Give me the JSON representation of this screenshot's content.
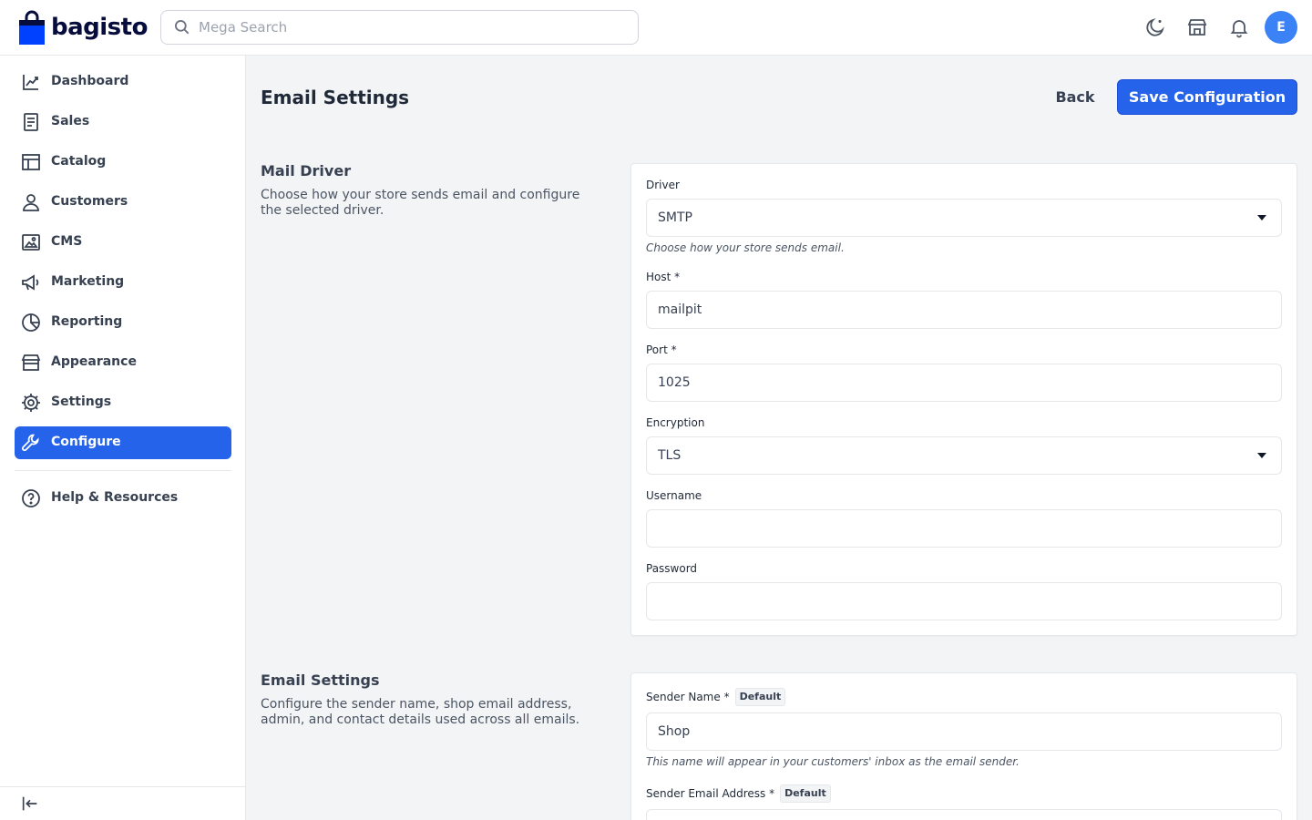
{
  "brand": {
    "name": "bagisto",
    "color": "#0041ff"
  },
  "search": {
    "placeholder": "Mega Search"
  },
  "header": {
    "avatar_initial": "E",
    "icons": [
      "dark-mode-icon",
      "storefront-icon",
      "notification-bell-icon"
    ]
  },
  "sidebar": {
    "items": [
      {
        "label": "Dashboard",
        "icon": "dashboard-icon"
      },
      {
        "label": "Sales",
        "icon": "sales-icon"
      },
      {
        "label": "Catalog",
        "icon": "catalog-icon"
      },
      {
        "label": "Customers",
        "icon": "customers-icon"
      },
      {
        "label": "CMS",
        "icon": "cms-icon"
      },
      {
        "label": "Marketing",
        "icon": "marketing-icon"
      },
      {
        "label": "Reporting",
        "icon": "reporting-icon"
      },
      {
        "label": "Appearance",
        "icon": "appearance-icon"
      },
      {
        "label": "Settings",
        "icon": "settings-icon"
      },
      {
        "label": "Configure",
        "icon": "configure-icon",
        "active": true
      }
    ],
    "help": {
      "label": "Help & Resources",
      "icon": "help-icon"
    }
  },
  "page": {
    "title": "Email Settings",
    "back_label": "Back",
    "save_label": "Save Configuration"
  },
  "mail_driver": {
    "title": "Mail Driver",
    "description": "Choose how your store sends email and configure the selected driver.",
    "driver": {
      "label": "Driver",
      "value": "SMTP",
      "hint": "Choose how your store sends email."
    },
    "host": {
      "label": "Host *",
      "value": "mailpit"
    },
    "port": {
      "label": "Port *",
      "value": "1025"
    },
    "encryption": {
      "label": "Encryption",
      "value": "TLS"
    },
    "username": {
      "label": "Username",
      "value": ""
    },
    "password": {
      "label": "Password",
      "value": ""
    }
  },
  "email_settings": {
    "title": "Email Settings",
    "description": "Configure the sender name, shop email address, admin, and contact details used across all emails.",
    "sender_name": {
      "label": "Sender Name *",
      "badge": "Default",
      "value": "Shop",
      "hint": "This name will appear in your customers' inbox as the email sender."
    },
    "sender_email": {
      "label": "Sender Email Address *",
      "badge": "Default"
    }
  },
  "colors": {
    "accent": "#2563eb",
    "avatar": "#3b82f6"
  }
}
